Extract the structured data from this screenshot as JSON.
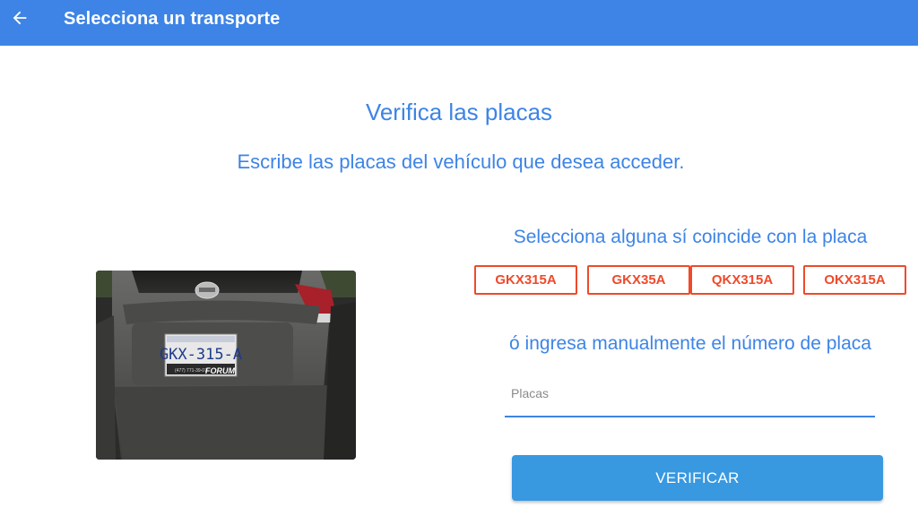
{
  "appbar": {
    "title": "Selecciona un transporte",
    "back_icon": "arrow-left-icon",
    "color": "#3d84e6"
  },
  "main": {
    "heading": "Verifica las placas",
    "subheading": "Escribe las placas del vehículo que desea acceder.",
    "photo": {
      "plate_text": "GKX-315-A",
      "dealer_text": "FORUM",
      "phone_text": "(477) 771-39-07"
    },
    "suggestions": {
      "label": "Selecciona alguna sí coincide con la placa",
      "options": [
        "GKX315A",
        "GKX35A",
        "QKX315A",
        "OKX315A"
      ],
      "color": "#ee4a2b"
    },
    "manual": {
      "label": "ó ingresa manualmente el número de placa",
      "placeholder": "Placas",
      "value": ""
    },
    "verify_button": {
      "label": "VERIFICAR",
      "color": "#3898e0"
    }
  }
}
